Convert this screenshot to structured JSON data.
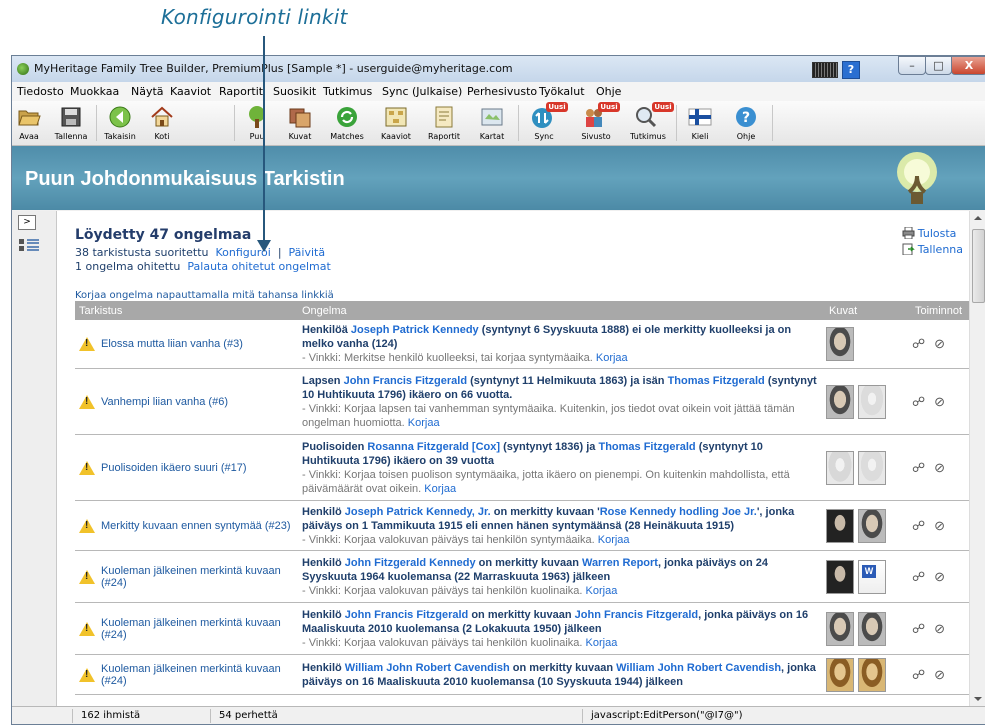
{
  "annotation": {
    "label": "Konfigurointi linkit"
  },
  "window": {
    "title": "MyHeritage Family Tree Builder, PremiumPlus [Sample *] - userguide@myheritage.com",
    "help_glyph": "?",
    "minimize": "–",
    "maximize": "□",
    "close": "X"
  },
  "menu": [
    "Tiedosto",
    "Muokkaa",
    "Näytä",
    "Kaaviot",
    "Raportit",
    "Suosikit",
    "Tutkimus",
    "Sync (Julkaise)",
    "Perhesivusto",
    "Työkalut",
    "Ohje"
  ],
  "toolbar": {
    "buttons": [
      {
        "label": "Avaa",
        "icon": "folder-open-icon"
      },
      {
        "label": "Tallenna",
        "icon": "floppy-disk-icon"
      },
      {
        "label": "Takaisin",
        "icon": "back-arrow-icon"
      },
      {
        "label": "Koti",
        "icon": "home-icon"
      },
      {
        "label": "Puu",
        "icon": "tree-icon"
      },
      {
        "label": "Kuvat",
        "icon": "photos-icon"
      },
      {
        "label": "Matches",
        "icon": "matches-icon"
      },
      {
        "label": "Kaaviot",
        "icon": "charts-icon"
      },
      {
        "label": "Raportit",
        "icon": "reports-icon"
      },
      {
        "label": "Kartat",
        "icon": "maps-icon"
      },
      {
        "label": "Sync",
        "icon": "sync-icon",
        "badge": "Uusi"
      },
      {
        "label": "Sivusto",
        "icon": "family-site-icon",
        "badge": "Uusi"
      },
      {
        "label": "Tutkimus",
        "icon": "research-icon",
        "badge": "Uusi"
      },
      {
        "label": "Kieli",
        "icon": "finnish-flag-icon"
      },
      {
        "label": "Ohje",
        "icon": "help-icon"
      }
    ]
  },
  "header": {
    "title": "Puun Johdonmukaisuus Tarkistin"
  },
  "leftpanel": {
    "toggle": ">"
  },
  "summary": {
    "found": "Löydetty 47 ongelmaa",
    "checks_done": "38 tarkistusta suoritettu",
    "configure": "Konfiguroi",
    "separator": "|",
    "refresh": "Päivitä",
    "ignored": "1 ongelma ohitettu",
    "restore": "Palauta ohitetut ongelmat",
    "hint": "Korjaa ongelma napauttamalla mitä tahansa linkkiä"
  },
  "actions": {
    "print": "Tulosta",
    "save": "Tallenna"
  },
  "table": {
    "headers": [
      "Tarkistus",
      "Ongelma",
      "Kuvat",
      "Toiminnot"
    ],
    "rows": [
      {
        "check": "Elossa mutta liian vanha (#3)",
        "pre": "Henkilöä ",
        "p1": "Joseph Patrick Kennedy",
        "mid": " (syntynyt 6 Syyskuuta 1888) ei ole merkitty kuolleeksi ja on melko vanha (124)",
        "tip": "- Vinkki: Merkitse henkilö kuolleeksi, tai korjaa syntymäaika.",
        "fix": "Korjaa",
        "thumbs": [
          "photo"
        ]
      },
      {
        "check": "Vanhempi liian vanha (#6)",
        "pre": "Lapsen ",
        "p1": "John Francis Fitzgerald",
        "mid": " (syntynyt 11 Helmikuuta 1863) ja isän ",
        "p2": "Thomas Fitzgerald",
        "post": " (syntynyt 10 Huhtikuuta 1796) ikäero on 66 vuotta.",
        "tip": "- Vinkki: Korjaa lapsen tai vanhemman syntymäaika. Kuitenkin, jos tiedot ovat oikein voit jättää tämän ongelman huomiotta.",
        "fix": "Korjaa",
        "thumbs": [
          "photo",
          "silhouette"
        ]
      },
      {
        "check": "Puolisoiden ikäero suuri (#17)",
        "pre": "Puolisoiden ",
        "p1": "Rosanna Fitzgerald [Cox]",
        "mid": " (syntynyt 1836) ja ",
        "p2": "Thomas Fitzgerald",
        "post": " (syntynyt 10 Huhtikuuta 1796) ikäero on 39 vuotta",
        "tip": "- Vinkki: Korjaa toisen puolison syntymäaika, jotta ikäero on pienempi. On kuitenkin mahdollista, että päivämäärät ovat oikein.",
        "fix": "Korjaa",
        "thumbs": [
          "female",
          "silhouette"
        ]
      },
      {
        "check": "Merkitty kuvaan ennen syntymää (#23)",
        "pre": "Henkilö ",
        "p1": "Joseph Patrick Kennedy, Jr.",
        "mid": " on merkitty kuvaan '",
        "p2": "Rose Kennedy hodling Joe Jr.",
        "post": "', jonka päiväys on 1 Tammikuuta 1915 eli ennen hänen syntymäänsä (28 Heinäkuuta 1915)",
        "tip": "- Vinkki: Korjaa valokuvan päiväys tai henkilön syntymäaika.",
        "fix": "Korjaa",
        "thumbs": [
          "dark",
          "photo"
        ]
      },
      {
        "check": "Kuoleman jälkeinen merkintä kuvaan (#24)",
        "pre": "Henkilö ",
        "p1": "John Fitzgerald Kennedy",
        "mid": " on merkitty kuvaan ",
        "p2": "Warren Report",
        "post": ", jonka päiväys on 24 Syyskuuta 1964 kuolemansa (22 Marraskuuta 1963) jälkeen",
        "tip": "- Vinkki: Korjaa valokuvan päiväys tai henkilön kuolinaika.",
        "fix": "Korjaa",
        "thumbs": [
          "dark",
          "doc"
        ]
      },
      {
        "check": "Kuoleman jälkeinen merkintä kuvaan (#24)",
        "pre": "Henkilö ",
        "p1": "John Francis Fitzgerald",
        "mid": " on merkitty kuvaan ",
        "p2": "John Francis Fitzgerald",
        "post": ", jonka päiväys on 16 Maaliskuuta 2010 kuolemansa (2 Lokakuuta 1950) jälkeen",
        "tip": "- Vinkki: Korjaa valokuvan päiväys tai henkilön kuolinaika.",
        "fix": "Korjaa",
        "thumbs": [
          "photo",
          "photo"
        ]
      },
      {
        "check": "Kuoleman jälkeinen merkintä kuvaan (#24)",
        "pre": "Henkilö ",
        "p1": "William John Robert Cavendish",
        "mid": " on merkitty kuvaan ",
        "p2": "William John Robert Cavendish",
        "post": ", jonka päiväys on 16 Maaliskuuta 2010 kuolemansa (10 Syyskuuta 1944) jälkeen",
        "tip": "",
        "fix": "",
        "thumbs": [
          "sepia",
          "sepia"
        ]
      }
    ]
  },
  "statusbar": {
    "people": "162 ihmistä",
    "families": "54 perhettä",
    "script": "javascript:EditPerson(\"@I7@\")"
  }
}
